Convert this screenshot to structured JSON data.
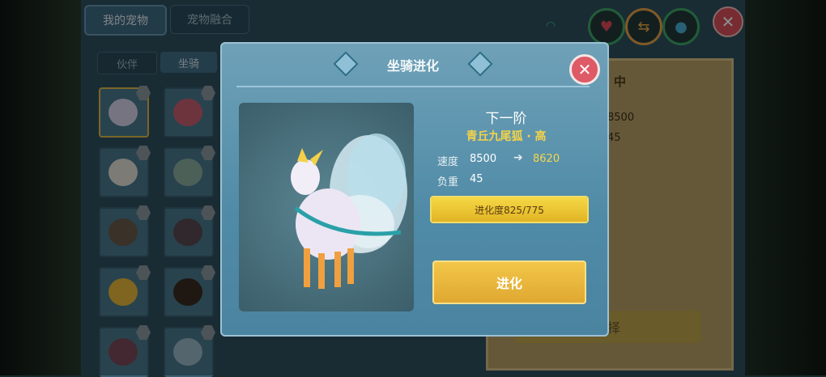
{
  "tabs": {
    "my_pets": "我的宠物",
    "pet_fusion": "宠物融合"
  },
  "subtabs": {
    "partner": "伙伴",
    "mount": "坐骑"
  },
  "status_icons": [
    "wifi-icon",
    "heart-icon",
    "swap-icon",
    "water-icon"
  ],
  "background_panel": {
    "title_fragment": "中",
    "val1": "8500",
    "val2": "45",
    "button_fragment": "择"
  },
  "modal": {
    "title": "坐骑进化",
    "next_stage": "下一阶",
    "mount_name": "青丘九尾狐 · 高",
    "stats": [
      {
        "label": "速度",
        "current": "8500",
        "next": "8620"
      },
      {
        "label": "负重",
        "current": "45"
      }
    ],
    "progress": {
      "text": "进化度825/775",
      "current": 825,
      "max": 775
    },
    "evolve_button": "进化"
  },
  "colors": {
    "accent_yellow": "#f2d24a",
    "modal_blue": "#5b93ad",
    "close_red": "#de5a66"
  }
}
